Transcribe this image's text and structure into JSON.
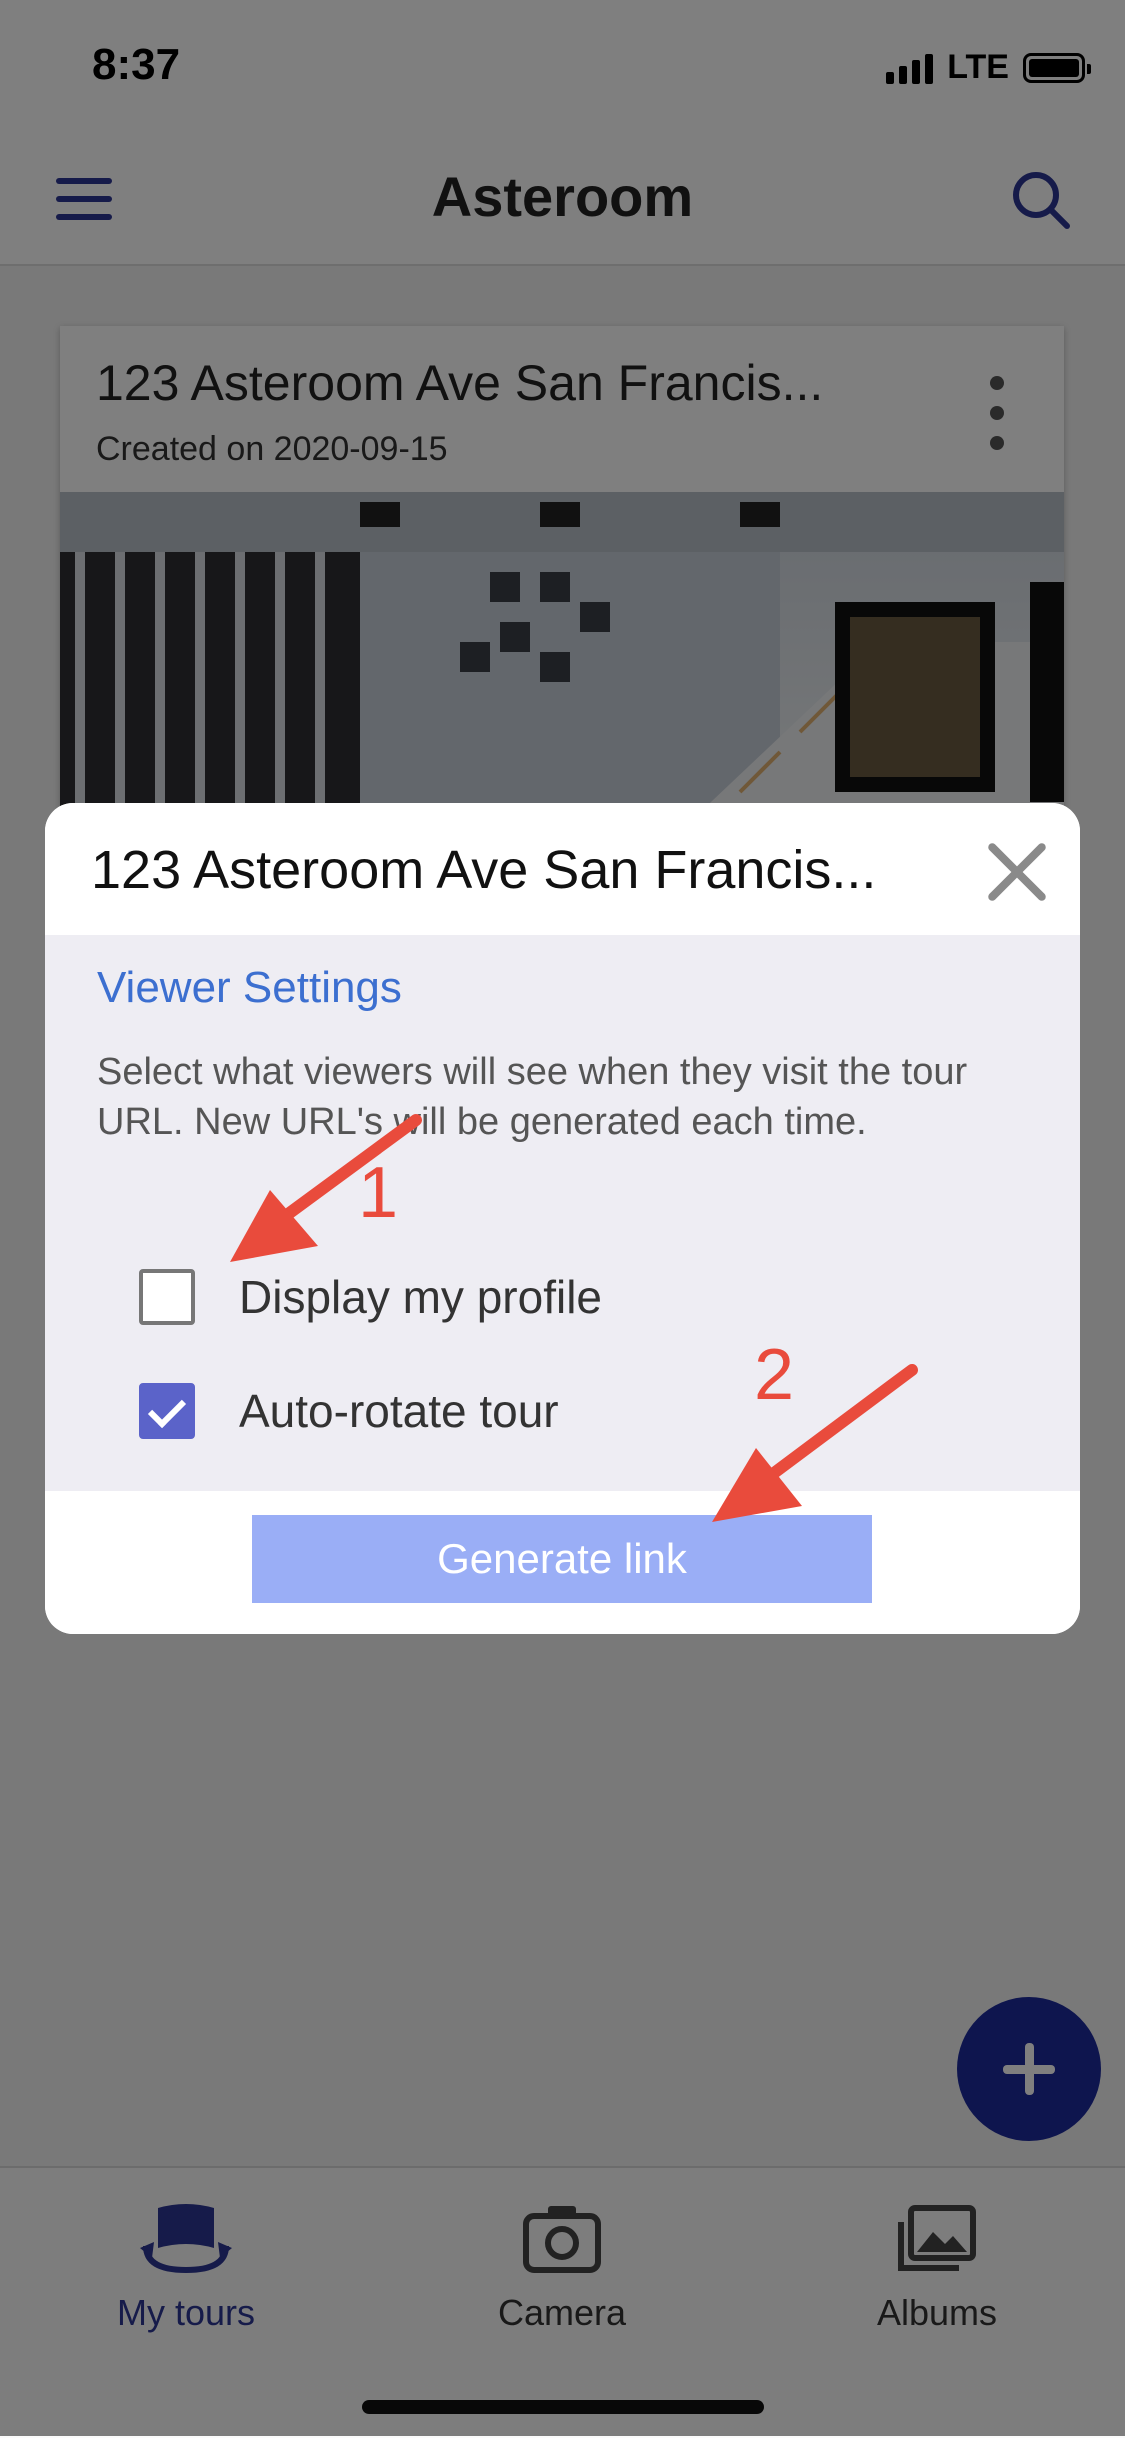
{
  "status_bar": {
    "time": "8:37",
    "network": "LTE"
  },
  "header": {
    "title": "Asteroom",
    "menu_icon": "hamburger-menu-icon",
    "search_icon": "search-icon"
  },
  "tour_card": {
    "name": "123 Asteroom Ave San Francis...",
    "created": "Created on 2020-09-15"
  },
  "modal": {
    "title": "123 Asteroom Ave San Francis...",
    "section_title": "Viewer Settings",
    "description": "Select what viewers will see when they visit the tour URL. New URL's will be generated each time.",
    "options": [
      {
        "label": "Display my profile",
        "checked": false
      },
      {
        "label": "Auto-rotate tour",
        "checked": true
      }
    ],
    "button_label": "Generate link"
  },
  "annotations": {
    "step1": "1",
    "step2": "2",
    "color": "#e94b3c"
  },
  "tabs": [
    {
      "label": "My tours",
      "icon": "tours-icon",
      "active": true
    },
    {
      "label": "Camera",
      "icon": "camera-icon",
      "active": false
    },
    {
      "label": "Albums",
      "icon": "albums-icon",
      "active": false
    }
  ],
  "colors": {
    "accent": "#2d3694",
    "fab": "#1d2a9c",
    "link_blue": "#3c6fd0",
    "button": "#9aaef6",
    "checkbox": "#5b63c9"
  }
}
